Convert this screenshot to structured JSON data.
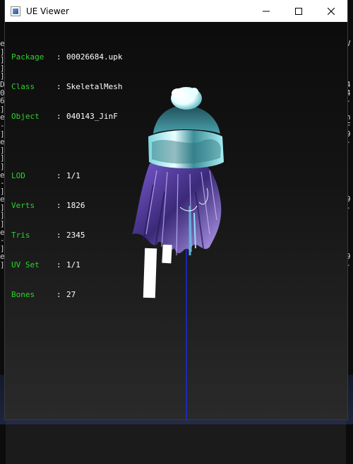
{
  "window": {
    "title": "UE Viewer"
  },
  "mesh_info": {
    "package_label": "Package",
    "package": "00026684.upk",
    "class_label": "Class",
    "class": "SkeletalMesh",
    "object_label": "Object",
    "object": "040143_JinF",
    "lod_label": "LOD",
    "lod": "1/1",
    "verts_label": "Verts",
    "verts": "1826",
    "tris_label": "Tris",
    "tris": "2345",
    "uvset_label": "UV Set",
    "uvset": "1/1",
    "bones_label": "Bones",
    "bones": "27"
  },
  "background_console": {
    "left_chars": [
      "e",
      "]",
      "]",
      "]",
      "]",
      "D",
      "0",
      "6",
      "]",
      "e",
      "-",
      "]",
      "e",
      "]",
      "]",
      "]",
      "e",
      "-",
      "]",
      "e",
      "]",
      "]",
      "]",
      "e",
      "-",
      "]",
      "e",
      "]"
    ],
    "right_chars": [
      "V",
      "",
      "",
      "",
      "",
      "4",
      "4",
      "-",
      "",
      "n",
      "F",
      "9",
      "-",
      "",
      "",
      "",
      "",
      "",
      "",
      "9",
      "-",
      "",
      "",
      "",
      "",
      "",
      "9",
      "-"
    ]
  },
  "colors": {
    "label_green": "#2fd12f",
    "value_white": "#ffffff",
    "viewport_bg": "#1b1b1b",
    "titlebar_bg": "#ffffff"
  }
}
